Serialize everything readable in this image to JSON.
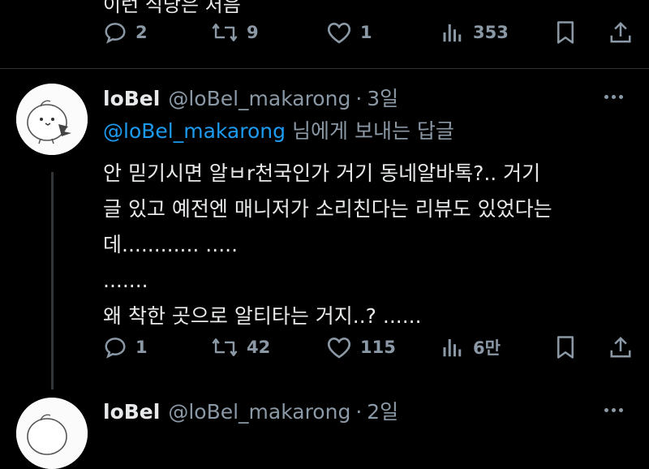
{
  "top_tweet": {
    "cut_text": "이런 식당은 처음",
    "actions": {
      "replies": "2",
      "retweets": "9",
      "likes": "1",
      "views": "353"
    }
  },
  "reply_tweet": {
    "name": "loBel",
    "handle": "@loBel_makarong",
    "separator": "·",
    "time": "3일",
    "reply_to_mention": "@loBel_makarong",
    "reply_to_suffix": "님에게 보내는 답글",
    "lines": [
      "안 믿기시면 알ㅂr천국인가 거기 동네알바톡?.. 거기",
      "글 있고 예전엔 매니저가 소리친다는 리뷰도 있었다는",
      "데............ .....",
      ".......",
      "왜 착한 곳으로 알티타는 거지..? ......"
    ],
    "actions": {
      "replies": "1",
      "retweets": "42",
      "likes": "115",
      "views": "6만"
    }
  },
  "next_tweet": {
    "name": "loBel",
    "handle": "@loBel_makarong",
    "separator": "·",
    "time": "2일"
  },
  "colors": {
    "background": "#000000",
    "text": "#e7e9ea",
    "muted": "#8b98a5",
    "accent": "#1d9bf0"
  },
  "icons": [
    "reply-icon",
    "retweet-icon",
    "like-icon",
    "views-icon",
    "bookmark-icon",
    "share-icon",
    "more-icon"
  ]
}
